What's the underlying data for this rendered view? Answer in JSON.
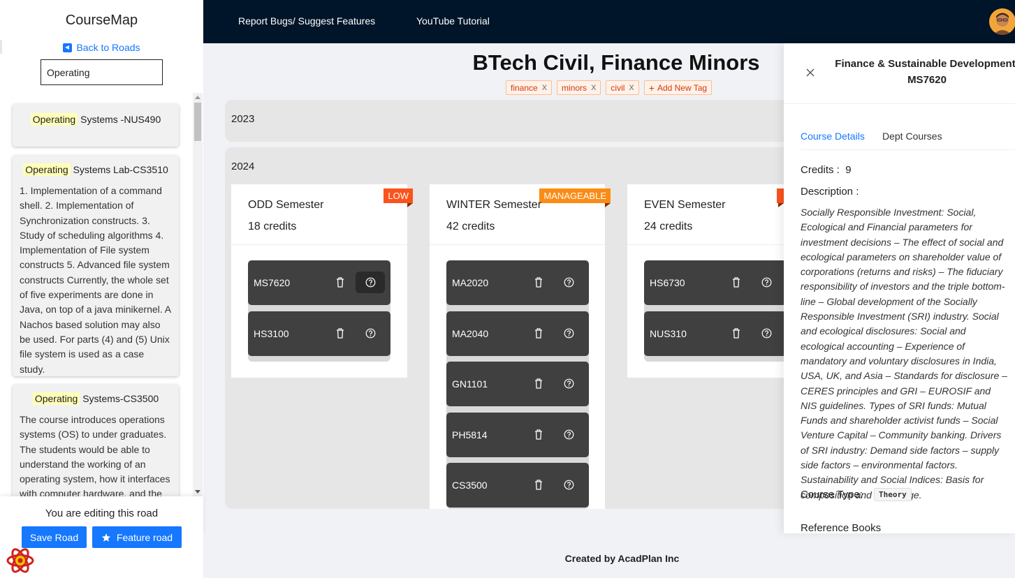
{
  "sidebar": {
    "brand": "CourseMap",
    "back_label": "Back to Roads",
    "search_value": "Operating",
    "results": [
      {
        "highlight": "Operating",
        "rest": " Systems -NUS490",
        "description": ""
      },
      {
        "highlight": "Operating",
        "rest": " Systems Lab-CS3510",
        "description": "1. Implementation of a command shell. 2. Implementation of Synchronization constructs. 3. Study of scheduling algorithms 4. Implementation of File system constructs 5. Advanced file system constructs Currently, the whole set of five experiments are done in Java, on top of a java minikernel. A Nachos based solution may also be used. For parts (4) and (5) Unix file system is used as a case study."
      },
      {
        "highlight": "Operating",
        "rest": " Systems-CS3500",
        "description": "The course introduces operations systems (OS) to under graduates. The students would be able to understand the working of an operating system, how it interfaces with computer hardware, and the"
      }
    ],
    "editing_text": "You are editing this road",
    "save_label": "Save Road",
    "feature_label": "Feature road"
  },
  "topbar": {
    "report_link": "Report Bugs/ Suggest Features",
    "youtube_link": "YouTube Tutorial"
  },
  "road": {
    "title": "BTech Civil, Finance Minors",
    "tags": [
      "finance",
      "minors",
      "civil"
    ],
    "add_tag_label": "Add New Tag",
    "years": [
      "2023",
      "2024"
    ],
    "semesters": [
      {
        "name": "ODD Semester",
        "credits": "18 credits",
        "badge": "LOW",
        "courses": [
          "MS7620",
          "HS3100"
        ]
      },
      {
        "name": "WINTER Semester",
        "credits": "42 credits",
        "badge": "MANAGEABLE",
        "courses": [
          "MA2020",
          "MA2040",
          "GN1101",
          "PH5814",
          "CS3500"
        ]
      },
      {
        "name": "EVEN Semester",
        "credits": "24 credits",
        "badge": "",
        "courses": [
          "HS6730",
          "NUS310"
        ]
      }
    ]
  },
  "footer": {
    "text": "Created by AcadPlan Inc"
  },
  "drawer": {
    "title": "Finance & Sustainable Development-MS7620",
    "tab_details": "Course Details",
    "tab_dept": "Dept Courses",
    "credits_label": "Credits :",
    "credits_value": "9",
    "description_label": "Description :",
    "description": "Socially Responsible Investment: Social, Ecological and Financial parameters for investment decisions – The effect of social and ecological parameters on shareholder value of corporations (returns and risks) – The fiduciary responsibility of investors and the triple bottom-line – Global development of the Socially Responsible Investment (SRI) industry. Social and ecological disclosures: Social and ecological accounting – Experience of mandatory and voluntary disclosures in India, USA, UK, and Asia – Standards for disclosure – CERES principles and GRI – EUROSIF and NIS guidelines. Types of SRI funds: Mutual Funds and shareholder activist funds – Social Venture Capital – Community banking. Drivers of SRI industry: Demand side factors – supply side factors – environmental factors. Sustainability and Social Indices: Basis for composition and weightage.",
    "course_type_label": "Course Type:",
    "course_type_value": "Theory",
    "reference_books_label": "Reference Books"
  },
  "colors": {
    "accent": "#1677ff",
    "nav_bg": "#001529",
    "badge_low": "#fa541c",
    "badge_manageable": "#fa8c16",
    "chip_bg": "#404040"
  }
}
